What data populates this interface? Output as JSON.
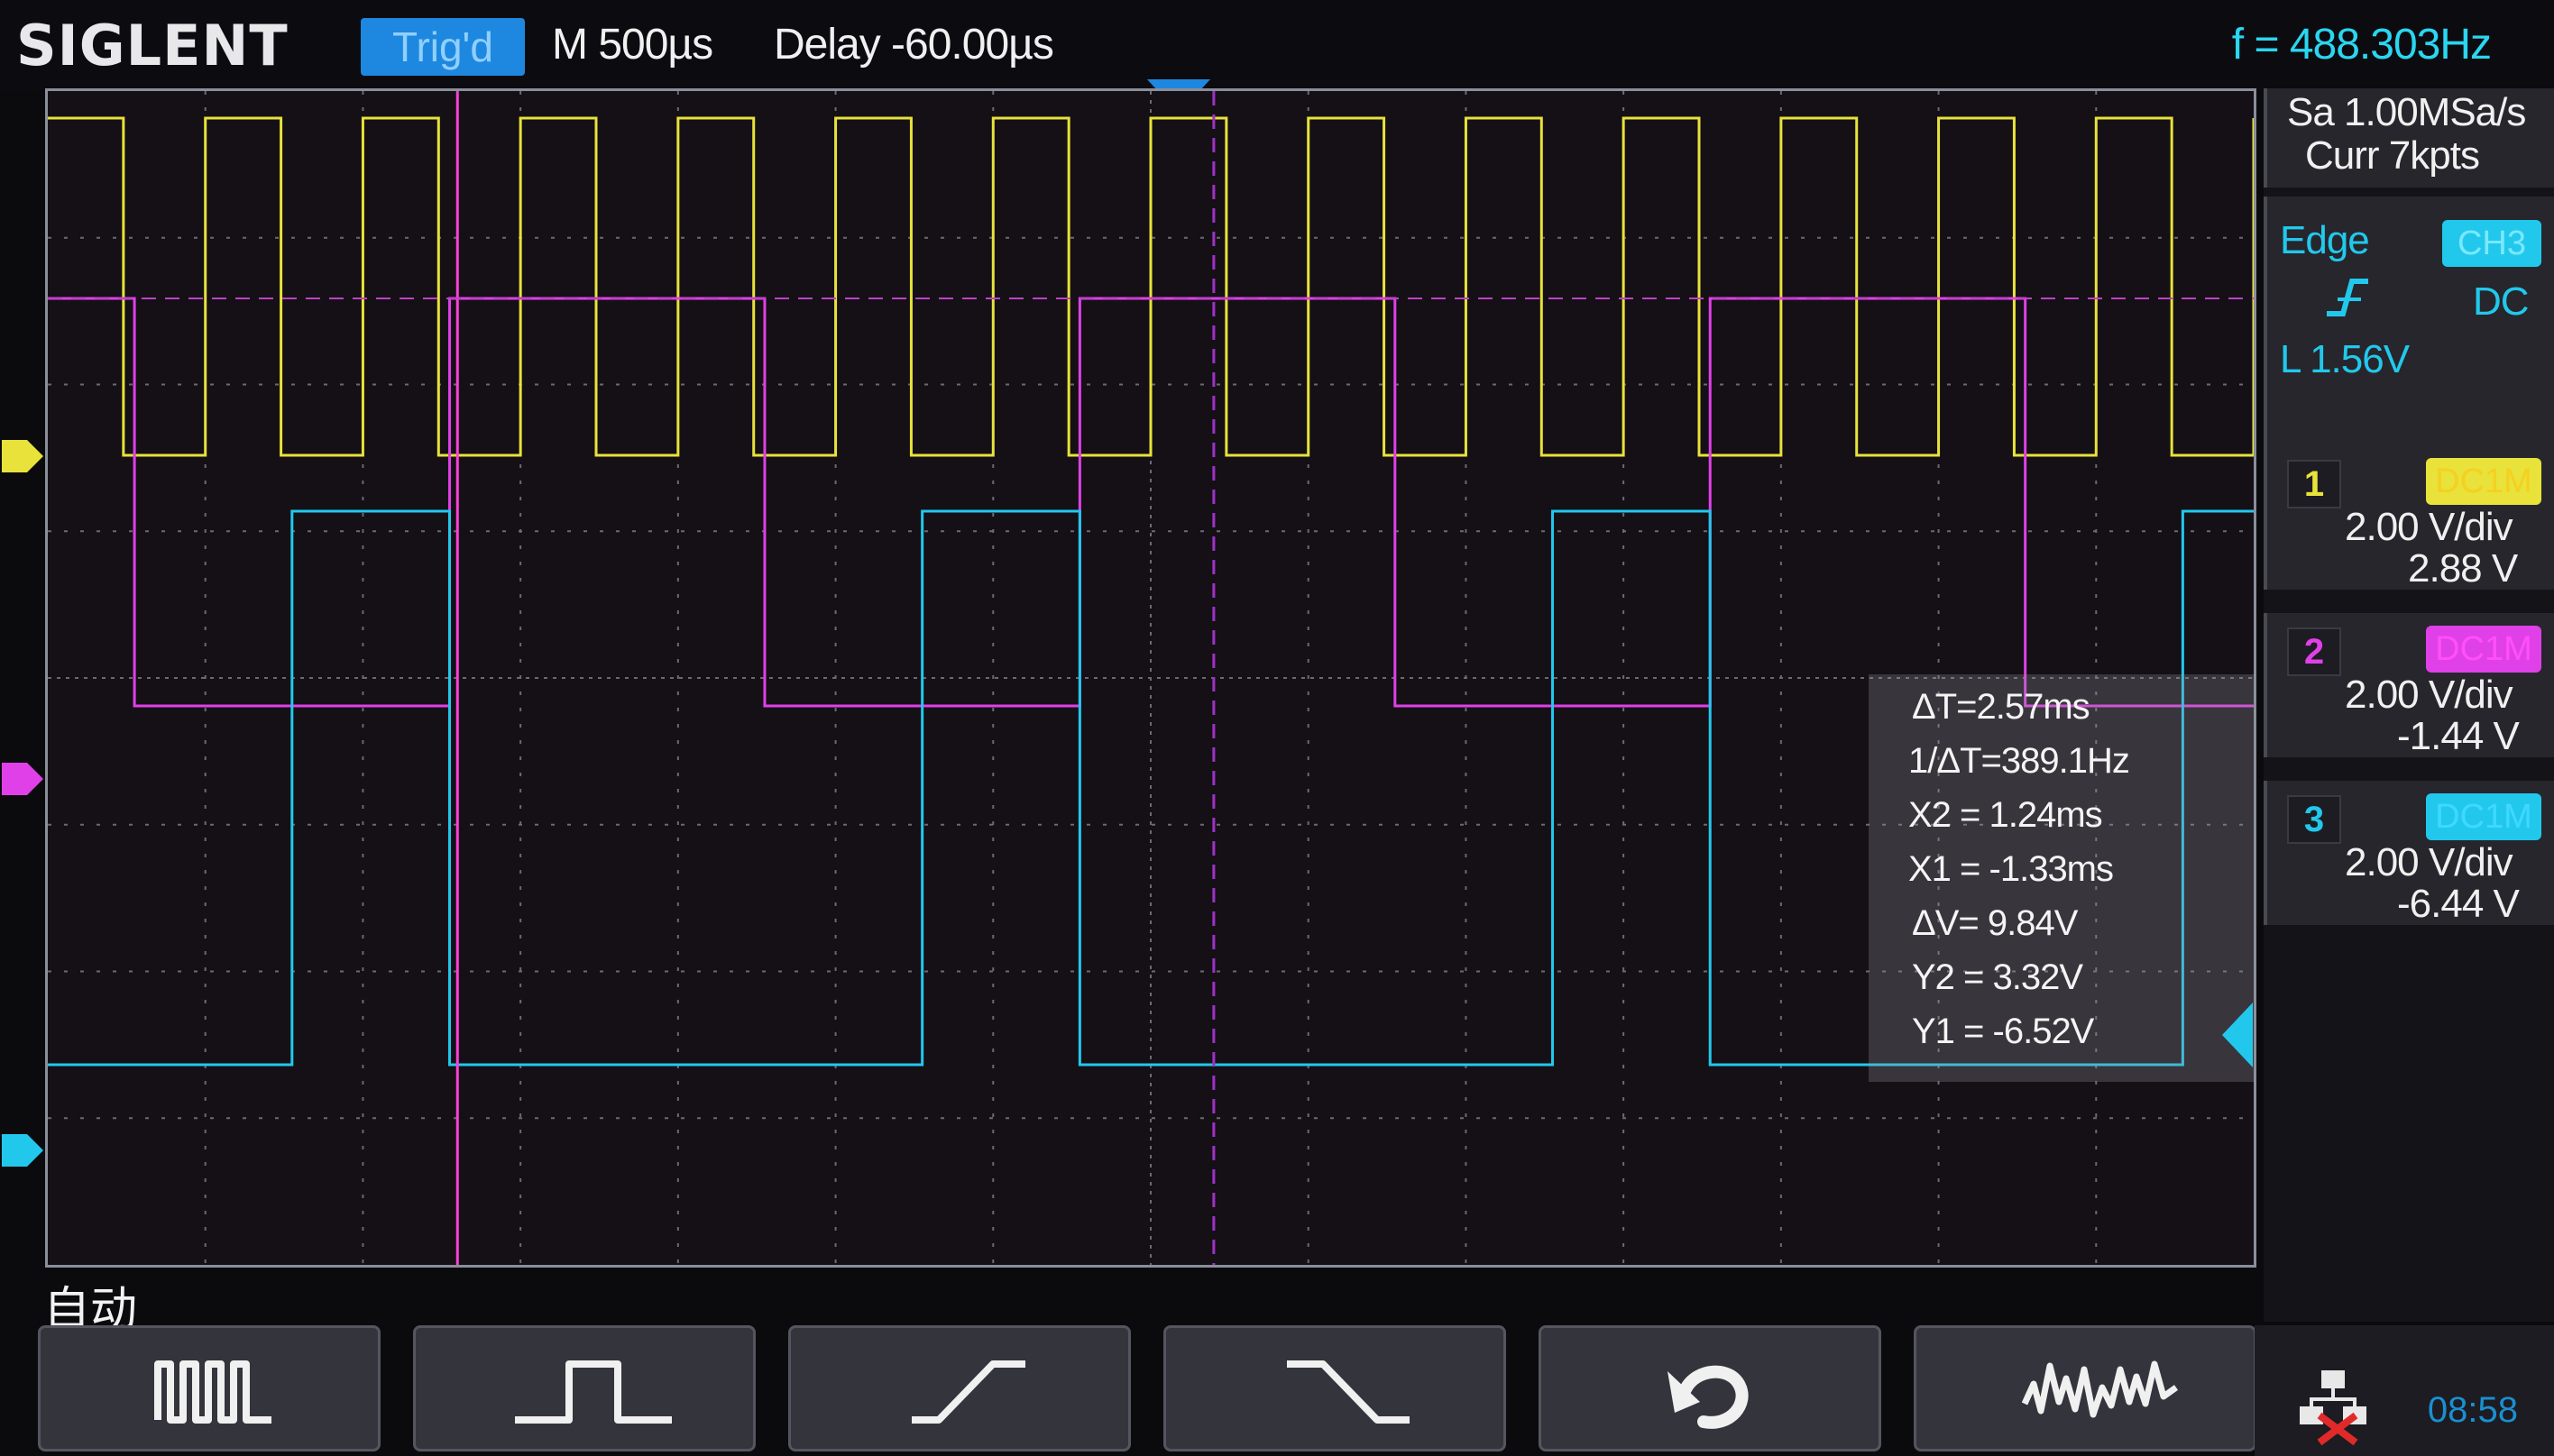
{
  "header": {
    "brand": "SIGLENT",
    "trigger_status": "Trig'd",
    "timebase": "M 500µs",
    "delay": "Delay -60.00µs",
    "frequency": "f = 488.303Hz"
  },
  "acquisition": {
    "sample_rate": "Sa 1.00MSa/s",
    "memory": "Curr 7kpts"
  },
  "trigger": {
    "type": "Edge",
    "source": "CH3",
    "coupling": "DC",
    "level": "L  1.56V"
  },
  "channels": [
    {
      "number": "1",
      "coupling": "DC1M",
      "scale": "2.00 V/div",
      "offset": "2.88 V",
      "color": "#e8e23a"
    },
    {
      "number": "2",
      "coupling": "DC1M",
      "scale": "2.00 V/div",
      "offset": "-1.44 V",
      "color": "#e040e8"
    },
    {
      "number": "3",
      "coupling": "DC1M",
      "scale": "2.00 V/div",
      "offset": "-6.44 V",
      "color": "#22c8ec"
    }
  ],
  "measurements": {
    "delta_t": "ΔT=2.57ms",
    "inv_delta_t": "1/ΔT=389.1Hz",
    "x2": "X2 = 1.24ms",
    "x1": "X1 = -1.33ms",
    "delta_v": "ΔV= 9.84V",
    "y2": "Y2 = 3.32V",
    "y1": "Y1 = -6.52V"
  },
  "footer": {
    "mode": "自动",
    "softkeys": [
      "pulse-train-icon",
      "single-pulse-icon",
      "rising-edge-icon",
      "falling-edge-icon",
      "undo-icon",
      "noise-icon"
    ],
    "clock": "08:58"
  },
  "colors": {
    "ch1": "#e8e23a",
    "ch2": "#e040e8",
    "ch3": "#22c8ec",
    "accent": "#1e88e0"
  }
}
